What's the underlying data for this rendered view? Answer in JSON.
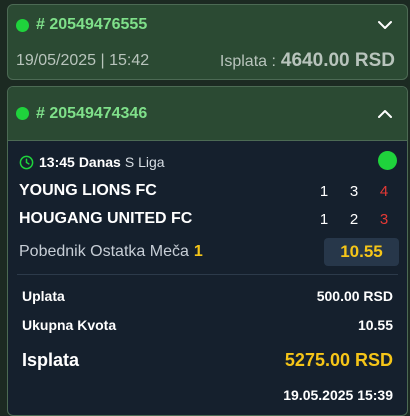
{
  "ticket1": {
    "id": "# 20549476555",
    "datetime": "19/05/2025 | 15:42",
    "payout_label": "Isplata :",
    "payout_amount": "4640.00 RSD",
    "expanded": false
  },
  "ticket2": {
    "id": "# 20549474346",
    "expanded": true,
    "match": {
      "time": "13:45",
      "day": "Danas",
      "league": "S Liga",
      "teams": [
        {
          "name": "YOUNG LIONS FC",
          "scores": [
            "1",
            "3",
            "4"
          ]
        },
        {
          "name": "HOUGANG UNITED FC",
          "scores": [
            "1",
            "2",
            "3"
          ]
        }
      ],
      "pick_label": "Pobednik Ostatka Meča",
      "pick_value": "1",
      "odd": "10.55"
    },
    "summary": {
      "stake_label": "Uplata",
      "stake_value": "500.00 RSD",
      "total_odds_label": "Ukupna Kvota",
      "total_odds_value": "10.55",
      "payout_label": "Isplata",
      "payout_value": "5275.00 RSD"
    },
    "timestamp": "19.05.2025 15:39"
  },
  "colors": {
    "live": "#1fd33c",
    "accent": "#f5c518",
    "loss_score": "#e53935",
    "header_bg": "#2b4a33"
  }
}
